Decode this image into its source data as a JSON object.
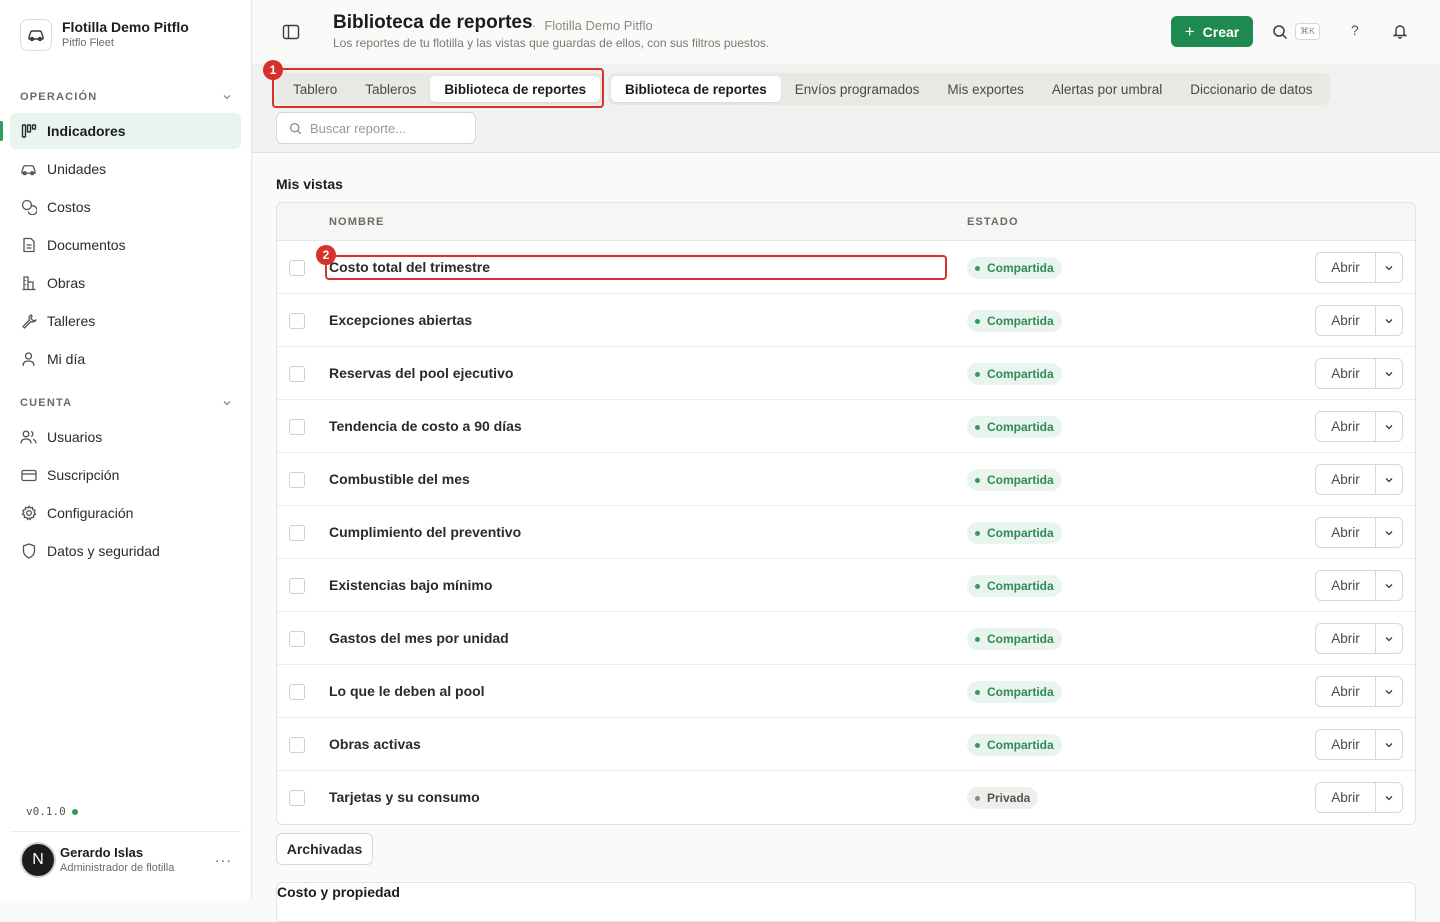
{
  "org": {
    "name": "Flotilla Demo Pitflo",
    "subtitle": "Pitflo Fleet"
  },
  "sidebar": {
    "section_operacion": "OPERACIÓN",
    "section_cuenta": "CUENTA",
    "items": [
      {
        "label": "Indicadores",
        "icon": "indicadores-icon",
        "active": true
      },
      {
        "label": "Unidades",
        "icon": "car-icon"
      },
      {
        "label": "Costos",
        "icon": "coins-icon"
      },
      {
        "label": "Documentos",
        "icon": "document-icon"
      },
      {
        "label": "Obras",
        "icon": "building-icon"
      },
      {
        "label": "Talleres",
        "icon": "wrench-icon"
      },
      {
        "label": "Mi día",
        "icon": "user-icon"
      }
    ],
    "account_items": [
      {
        "label": "Usuarios",
        "icon": "users-icon"
      },
      {
        "label": "Suscripción",
        "icon": "card-icon"
      },
      {
        "label": "Configuración",
        "icon": "gear-icon"
      },
      {
        "label": "Datos y seguridad",
        "icon": "shield-icon"
      }
    ],
    "version": "v0.1.0",
    "user": {
      "initial": "N",
      "name": "Gerardo Islas",
      "role": "Administrador de flotilla",
      "more": "···"
    }
  },
  "header": {
    "title": "Biblioteca de reportes",
    "crumb": "Flotilla Demo Pitflo",
    "subtitle": "Los reportes de tu flotilla y las vistas que guardas de ellos, con sus filtros puestos.",
    "create_label": "Crear",
    "create_plus": "+",
    "kbd": "⌘K",
    "help": "?"
  },
  "tabs_group1": [
    "Tablero",
    "Tableros",
    "Biblioteca de reportes"
  ],
  "tabs_group2": [
    "Biblioteca de reportes",
    "Envíos programados",
    "Mis exportes",
    "Alertas por umbral",
    "Diccionario de datos"
  ],
  "search": {
    "placeholder": "Buscar reporte..."
  },
  "annotations": {
    "one": "1",
    "two": "2"
  },
  "views": {
    "title": "Mis vistas",
    "col_nombre": "NOMBRE",
    "col_estado": "ESTADO",
    "open_label": "Abrir",
    "rows": [
      {
        "name": "Costo total del trimestre",
        "status": "Compartida"
      },
      {
        "name": "Excepciones abiertas",
        "status": "Compartida"
      },
      {
        "name": "Reservas del pool ejecutivo",
        "status": "Compartida"
      },
      {
        "name": "Tendencia de costo a 90 días",
        "status": "Compartida"
      },
      {
        "name": "Combustible del mes",
        "status": "Compartida"
      },
      {
        "name": "Cumplimiento del preventivo",
        "status": "Compartida"
      },
      {
        "name": "Existencias bajo mínimo",
        "status": "Compartida"
      },
      {
        "name": "Gastos del mes por unidad",
        "status": "Compartida"
      },
      {
        "name": "Lo que le deben al pool",
        "status": "Compartida"
      },
      {
        "name": "Obras activas",
        "status": "Compartida"
      },
      {
        "name": "Tarjetas y su consumo",
        "status": "Privada"
      }
    ],
    "archived_label": "Archivadas"
  },
  "section2_title": "Costo y propiedad",
  "colors": {
    "accent": "#1f8a50",
    "active_bg": "#eaf4ee",
    "annotation": "#d6322b"
  }
}
